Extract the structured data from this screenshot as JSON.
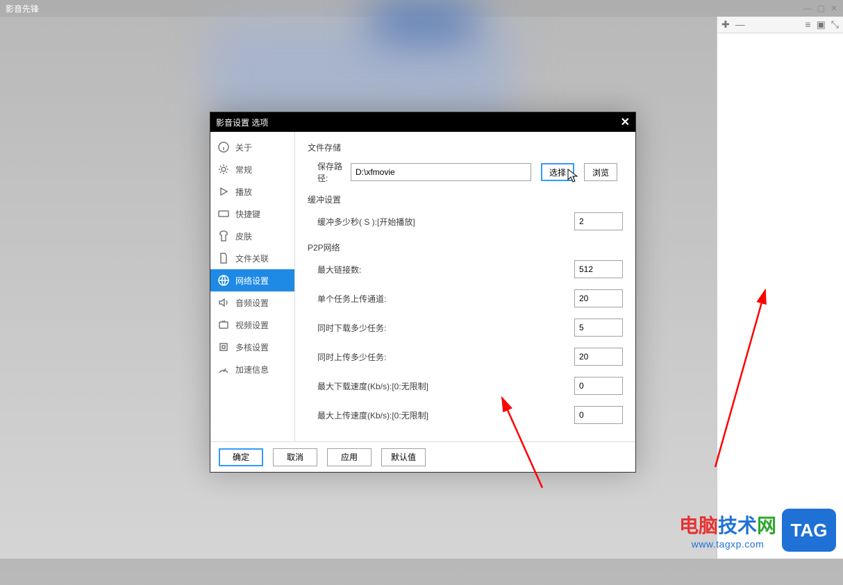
{
  "app": {
    "title": "影音先锋"
  },
  "window_controls": {
    "min": "—",
    "max": "▢",
    "close": "✕"
  },
  "side_toolbar": {
    "add": "✚",
    "remove": "—",
    "list": "≡",
    "layout": "▣",
    "ext": "⤡"
  },
  "dialog": {
    "title": "影音设置 选项",
    "close": "✕",
    "nav": [
      {
        "label": "关于"
      },
      {
        "label": "常规"
      },
      {
        "label": "播放"
      },
      {
        "label": "快捷键"
      },
      {
        "label": "皮肤"
      },
      {
        "label": "文件关联"
      },
      {
        "label": "网络设置"
      },
      {
        "label": "音频设置"
      },
      {
        "label": "视频设置"
      },
      {
        "label": "多核设置"
      },
      {
        "label": "加速信息"
      }
    ],
    "sections": {
      "file_storage_title": "文件存储",
      "save_path_label": "保存路径:",
      "save_path_value": "D:\\xfmovie",
      "choose_btn": "选择",
      "browse_btn": "浏览",
      "buffer_title": "缓冲设置",
      "buffer_label": "缓冲多少秒(  S  ):[开始播放]",
      "buffer_value": "2",
      "p2p_title": "P2P网络",
      "max_conn_label": "最大链接数:",
      "max_conn_value": "512",
      "upload_channel_label": "单个任务上传通道:",
      "upload_channel_value": "20",
      "max_down_tasks_label": "同时下载多少任务:",
      "max_down_tasks_value": "5",
      "max_up_tasks_label": "同时上传多少任务:",
      "max_up_tasks_value": "20",
      "max_down_speed_label": "最大下载速度(Kb/s):[0:无限制]",
      "max_down_speed_value": "0",
      "max_up_speed_label": "最大上传速度(Kb/s):[0:无限制]",
      "max_up_speed_value": "0"
    },
    "footer": {
      "ok": "确定",
      "cancel": "取消",
      "apply": "应用",
      "default": "默认值"
    }
  },
  "watermark": {
    "cn1": "电脑",
    "cn2": "技术",
    "cn3": "网",
    "url": "www.tagxp.com",
    "tag": "TAG"
  }
}
